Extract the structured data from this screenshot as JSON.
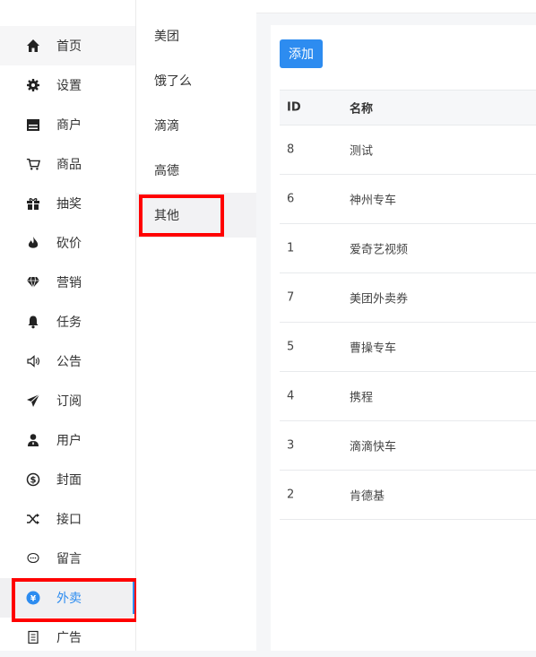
{
  "sidebar": {
    "items": [
      {
        "label": "首页",
        "icon": "home-icon"
      },
      {
        "label": "设置",
        "icon": "gear-icon"
      },
      {
        "label": "商户",
        "icon": "store-icon"
      },
      {
        "label": "商品",
        "icon": "cart-icon"
      },
      {
        "label": "抽奖",
        "icon": "gift-icon"
      },
      {
        "label": "砍价",
        "icon": "flame-icon"
      },
      {
        "label": "营销",
        "icon": "diamond-icon"
      },
      {
        "label": "任务",
        "icon": "bell-icon"
      },
      {
        "label": "公告",
        "icon": "speaker-icon"
      },
      {
        "label": "订阅",
        "icon": "paper-plane-icon"
      },
      {
        "label": "用户",
        "icon": "user-icon"
      },
      {
        "label": "封面",
        "icon": "dollar-circle-icon"
      },
      {
        "label": "接口",
        "icon": "shuffle-icon"
      },
      {
        "label": "留言",
        "icon": "chat-bubble-icon"
      },
      {
        "label": "外卖",
        "icon": "coupon-circle-icon",
        "active": true
      },
      {
        "label": "广告",
        "icon": "document-icon"
      }
    ]
  },
  "submenu": {
    "items": [
      {
        "label": "美团"
      },
      {
        "label": "饿了么"
      },
      {
        "label": "滴滴"
      },
      {
        "label": "高德"
      },
      {
        "label": "其他",
        "selected": true
      }
    ]
  },
  "toolbar": {
    "add_label": "添加"
  },
  "table": {
    "columns": [
      "ID",
      "名称"
    ],
    "rows": [
      {
        "id": "8",
        "name": "测试"
      },
      {
        "id": "6",
        "name": "神州专车"
      },
      {
        "id": "1",
        "name": "爱奇艺视频"
      },
      {
        "id": "7",
        "name": "美团外卖券"
      },
      {
        "id": "5",
        "name": "曹操专车"
      },
      {
        "id": "4",
        "name": "携程"
      },
      {
        "id": "3",
        "name": "滴滴快车"
      },
      {
        "id": "2",
        "name": "肯德基"
      }
    ]
  },
  "colors": {
    "accent": "#2d8cf0",
    "highlight": "#ff0000"
  }
}
